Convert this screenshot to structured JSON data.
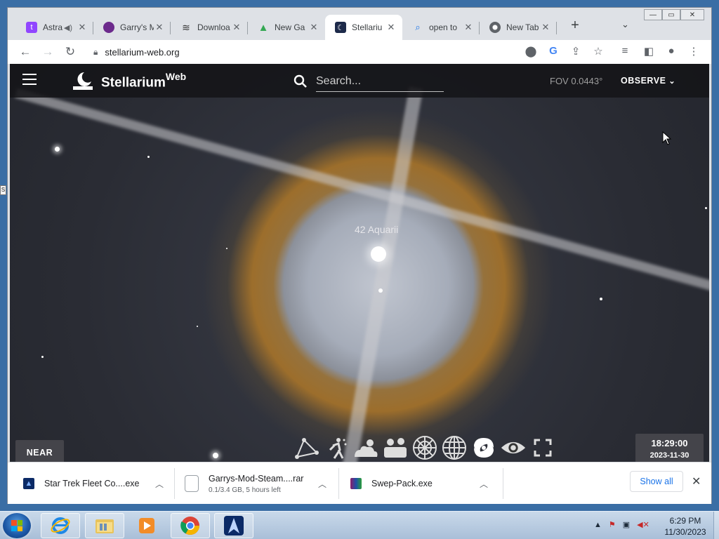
{
  "browser": {
    "tabs": [
      {
        "label": "Astra",
        "icon": "twitch-icon",
        "color": "#9146ff"
      },
      {
        "label": "Garry's M",
        "icon": "garrys-mod-icon",
        "color": "#6c2a8c"
      },
      {
        "label": "Downloa",
        "icon": "database-icon",
        "color": "#333"
      },
      {
        "label": "New Ga",
        "icon": "new-game-icon",
        "color": "#34a853"
      },
      {
        "label": "Stellariu",
        "icon": "stellarium-icon",
        "color": "#1d2a4a"
      },
      {
        "label": "open to",
        "icon": "search-icon",
        "color": "#1a73e8"
      },
      {
        "label": "New Tab",
        "icon": "chrome-icon",
        "color": "#5f6368"
      }
    ],
    "address": "stellarium-web.org"
  },
  "app": {
    "brand": "Stellarium",
    "brand_sup": "Web",
    "search_placeholder": "Search...",
    "fov": "FOV 0.0443°",
    "observe": "OBSERVE",
    "star_label": "42 Aquarii",
    "near_label": "NEAR",
    "time": "18:29:00",
    "date": "2023-11-30",
    "toolbar_buttons": [
      "constellation-lines-icon",
      "constellation-art-icon",
      "atmosphere-icon",
      "landscape-icon",
      "azimuthal-grid-icon",
      "equatorial-grid-icon",
      "deep-sky-objects-icon",
      "night-mode-icon",
      "fullscreen-icon"
    ]
  },
  "downloads": {
    "items": [
      {
        "name": "Star Trek Fleet Co....exe",
        "sub": ""
      },
      {
        "name": "Garrys-Mod-Steam....rar",
        "sub": "0.1/3.4 GB, 5 hours left"
      },
      {
        "name": "Swep-Pack.exe",
        "sub": ""
      }
    ],
    "show_all": "Show all"
  },
  "taskbar": {
    "time": "6:29 PM",
    "date": "11/30/2023"
  }
}
